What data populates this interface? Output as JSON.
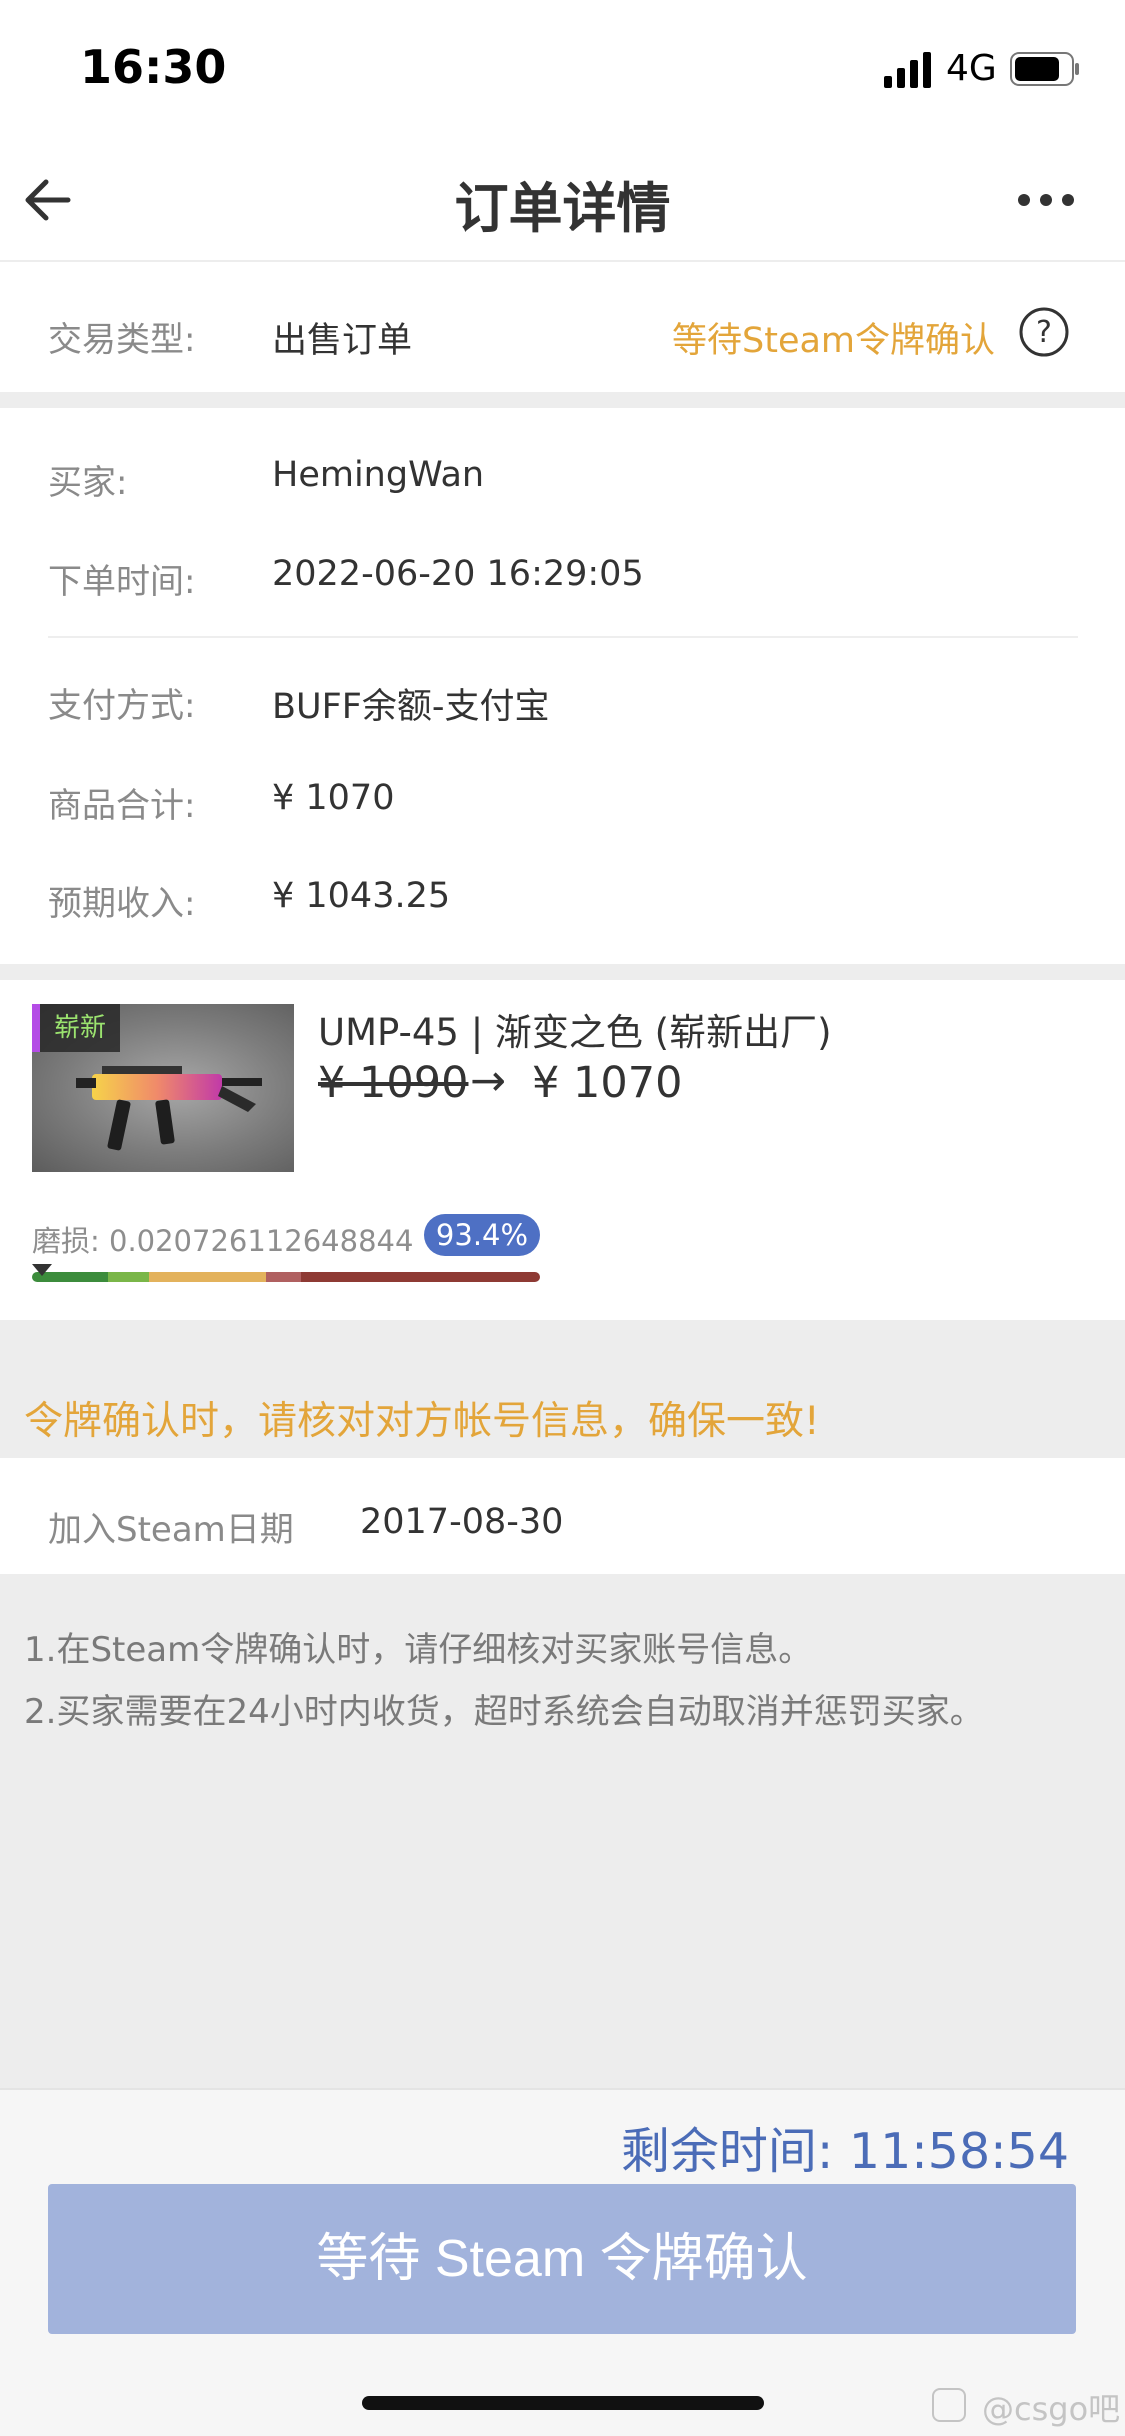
{
  "status_bar": {
    "time": "16:30",
    "network": "4G"
  },
  "nav": {
    "title": "订单详情"
  },
  "trade": {
    "type_label": "交易类型:",
    "type_value": "出售订单",
    "status": "等待Steam令牌确认"
  },
  "order": {
    "buyer_label": "买家:",
    "buyer_value": "HemingWan",
    "time_label": "下单时间:",
    "time_value": "2022-06-20 16:29:05",
    "pay_label": "支付方式:",
    "pay_value": "BUFF余额-支付宝",
    "total_label": "商品合计:",
    "total_value": "¥ 1070",
    "income_label": "预期收入:",
    "income_value": "¥ 1043.25"
  },
  "item": {
    "wear_tag": "崭新",
    "name": "UMP-45 | 渐变之色 (崭新出厂)",
    "old_price": "¥ 1090",
    "arrow": "→",
    "new_price": "¥ 1070",
    "wear_label": "磨损: 0.020726112648844",
    "wear_percent": "93.4%",
    "wear_value": 0.020726112648844,
    "wear_bar_colors": [
      "#3c8c3c",
      "#7ab648",
      "#e3b25c",
      "#b06060",
      "#8e3a34"
    ]
  },
  "warning": "令牌确认时，请核对对方帐号信息，确保一致!",
  "steam": {
    "label": "加入Steam日期",
    "value": "2017-08-30"
  },
  "notes": [
    "1.在Steam令牌确认时，请仔细核对买家账号信息。",
    "2.买家需要在24小时内收货，超时系统会自动取消并惩罚买家。"
  ],
  "footer": {
    "countdown": "剩余时间: 11:58:54",
    "button": "等待 Steam 令牌确认",
    "watermark": "@csgo吧"
  },
  "colors": {
    "accent_orange": "#e3a53a",
    "accent_blue": "#4b6cb7",
    "button_bg": "#a2b3dc"
  },
  "icons": [
    "back-arrow-icon",
    "more-dots-icon",
    "help-circle-icon",
    "signal-icon",
    "battery-icon"
  ]
}
